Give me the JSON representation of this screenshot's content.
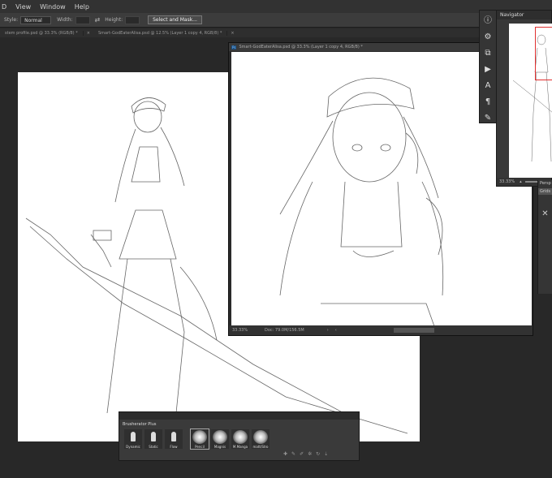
{
  "menubar": {
    "items": [
      "D",
      "View",
      "Window",
      "Help"
    ]
  },
  "options": {
    "style_label": "Style:",
    "style_value": "Normal",
    "width_label": "Width:",
    "height_label": "Height:",
    "mask_button": "Select and Mask..."
  },
  "tabs": [
    "stem profile.psd @ 33.3% (RGB/8) *",
    "Smart-GodEaterAlisa.psd @ 12.5% (Layer 1 copy 4, RGB/8) *"
  ],
  "doc2": {
    "title": "Smart-GodEaterAlisa.psd @ 33.3% (Layer 1 copy 4, RGB/8) *",
    "ps_badge": "Ps",
    "zoom": "33.33%",
    "doc_info": "Doc: 79.0M/156.5M"
  },
  "navigator": {
    "title": "Navigator",
    "zoom": "33.33%"
  },
  "perspective": {
    "title": "Persp",
    "tab": "Grids"
  },
  "brusherator": {
    "title": "Brusherator Plus",
    "brushes": [
      "Dynamic",
      "Static",
      "Flow",
      "Pencil",
      "Magnis",
      "M.Manga",
      "matt/Stro"
    ]
  },
  "colors": {
    "bg": "#282828",
    "panel": "#383838",
    "nav_box": "#e03030"
  }
}
